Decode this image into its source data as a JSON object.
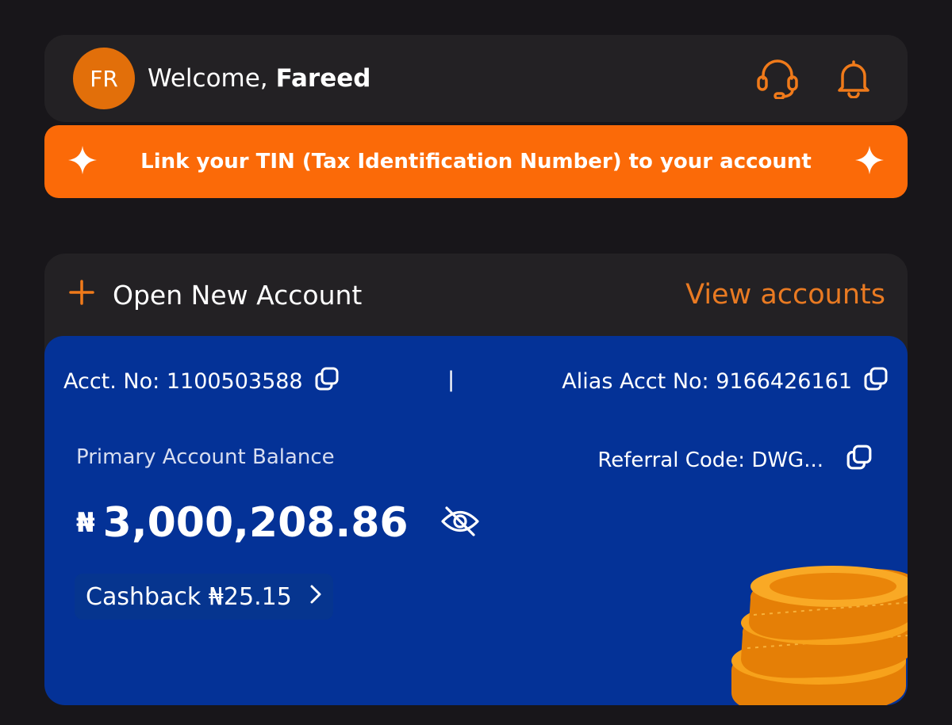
{
  "header": {
    "avatar_initials": "FR",
    "welcome_text": "Welcome,",
    "user_name": "Fareed",
    "icons": [
      "headset-icon",
      "bell-icon"
    ]
  },
  "banner": {
    "text": "Link your TIN (Tax Identification Number) to your account",
    "icons": [
      "sparkle-icon",
      "sparkle-icon"
    ]
  },
  "accounts": {
    "open_new_label": "Open New Account",
    "view_accounts_label": "View accounts"
  },
  "primary_account": {
    "acct_no_label": "Acct. No: 1100503588",
    "separator": "|",
    "alias_acct_label": "Alias Acct No: 9166426161",
    "balance_label": "Primary Account Balance",
    "referral_label": "Referral Code: DWG...",
    "currency_symbol": "₦",
    "balance_amount": "3,000,208.86",
    "cashback_label": "Cashback ₦25.15"
  },
  "colors": {
    "accent_orange": "#fb6a08",
    "card_blue": "#043297",
    "background": "#18161a"
  }
}
